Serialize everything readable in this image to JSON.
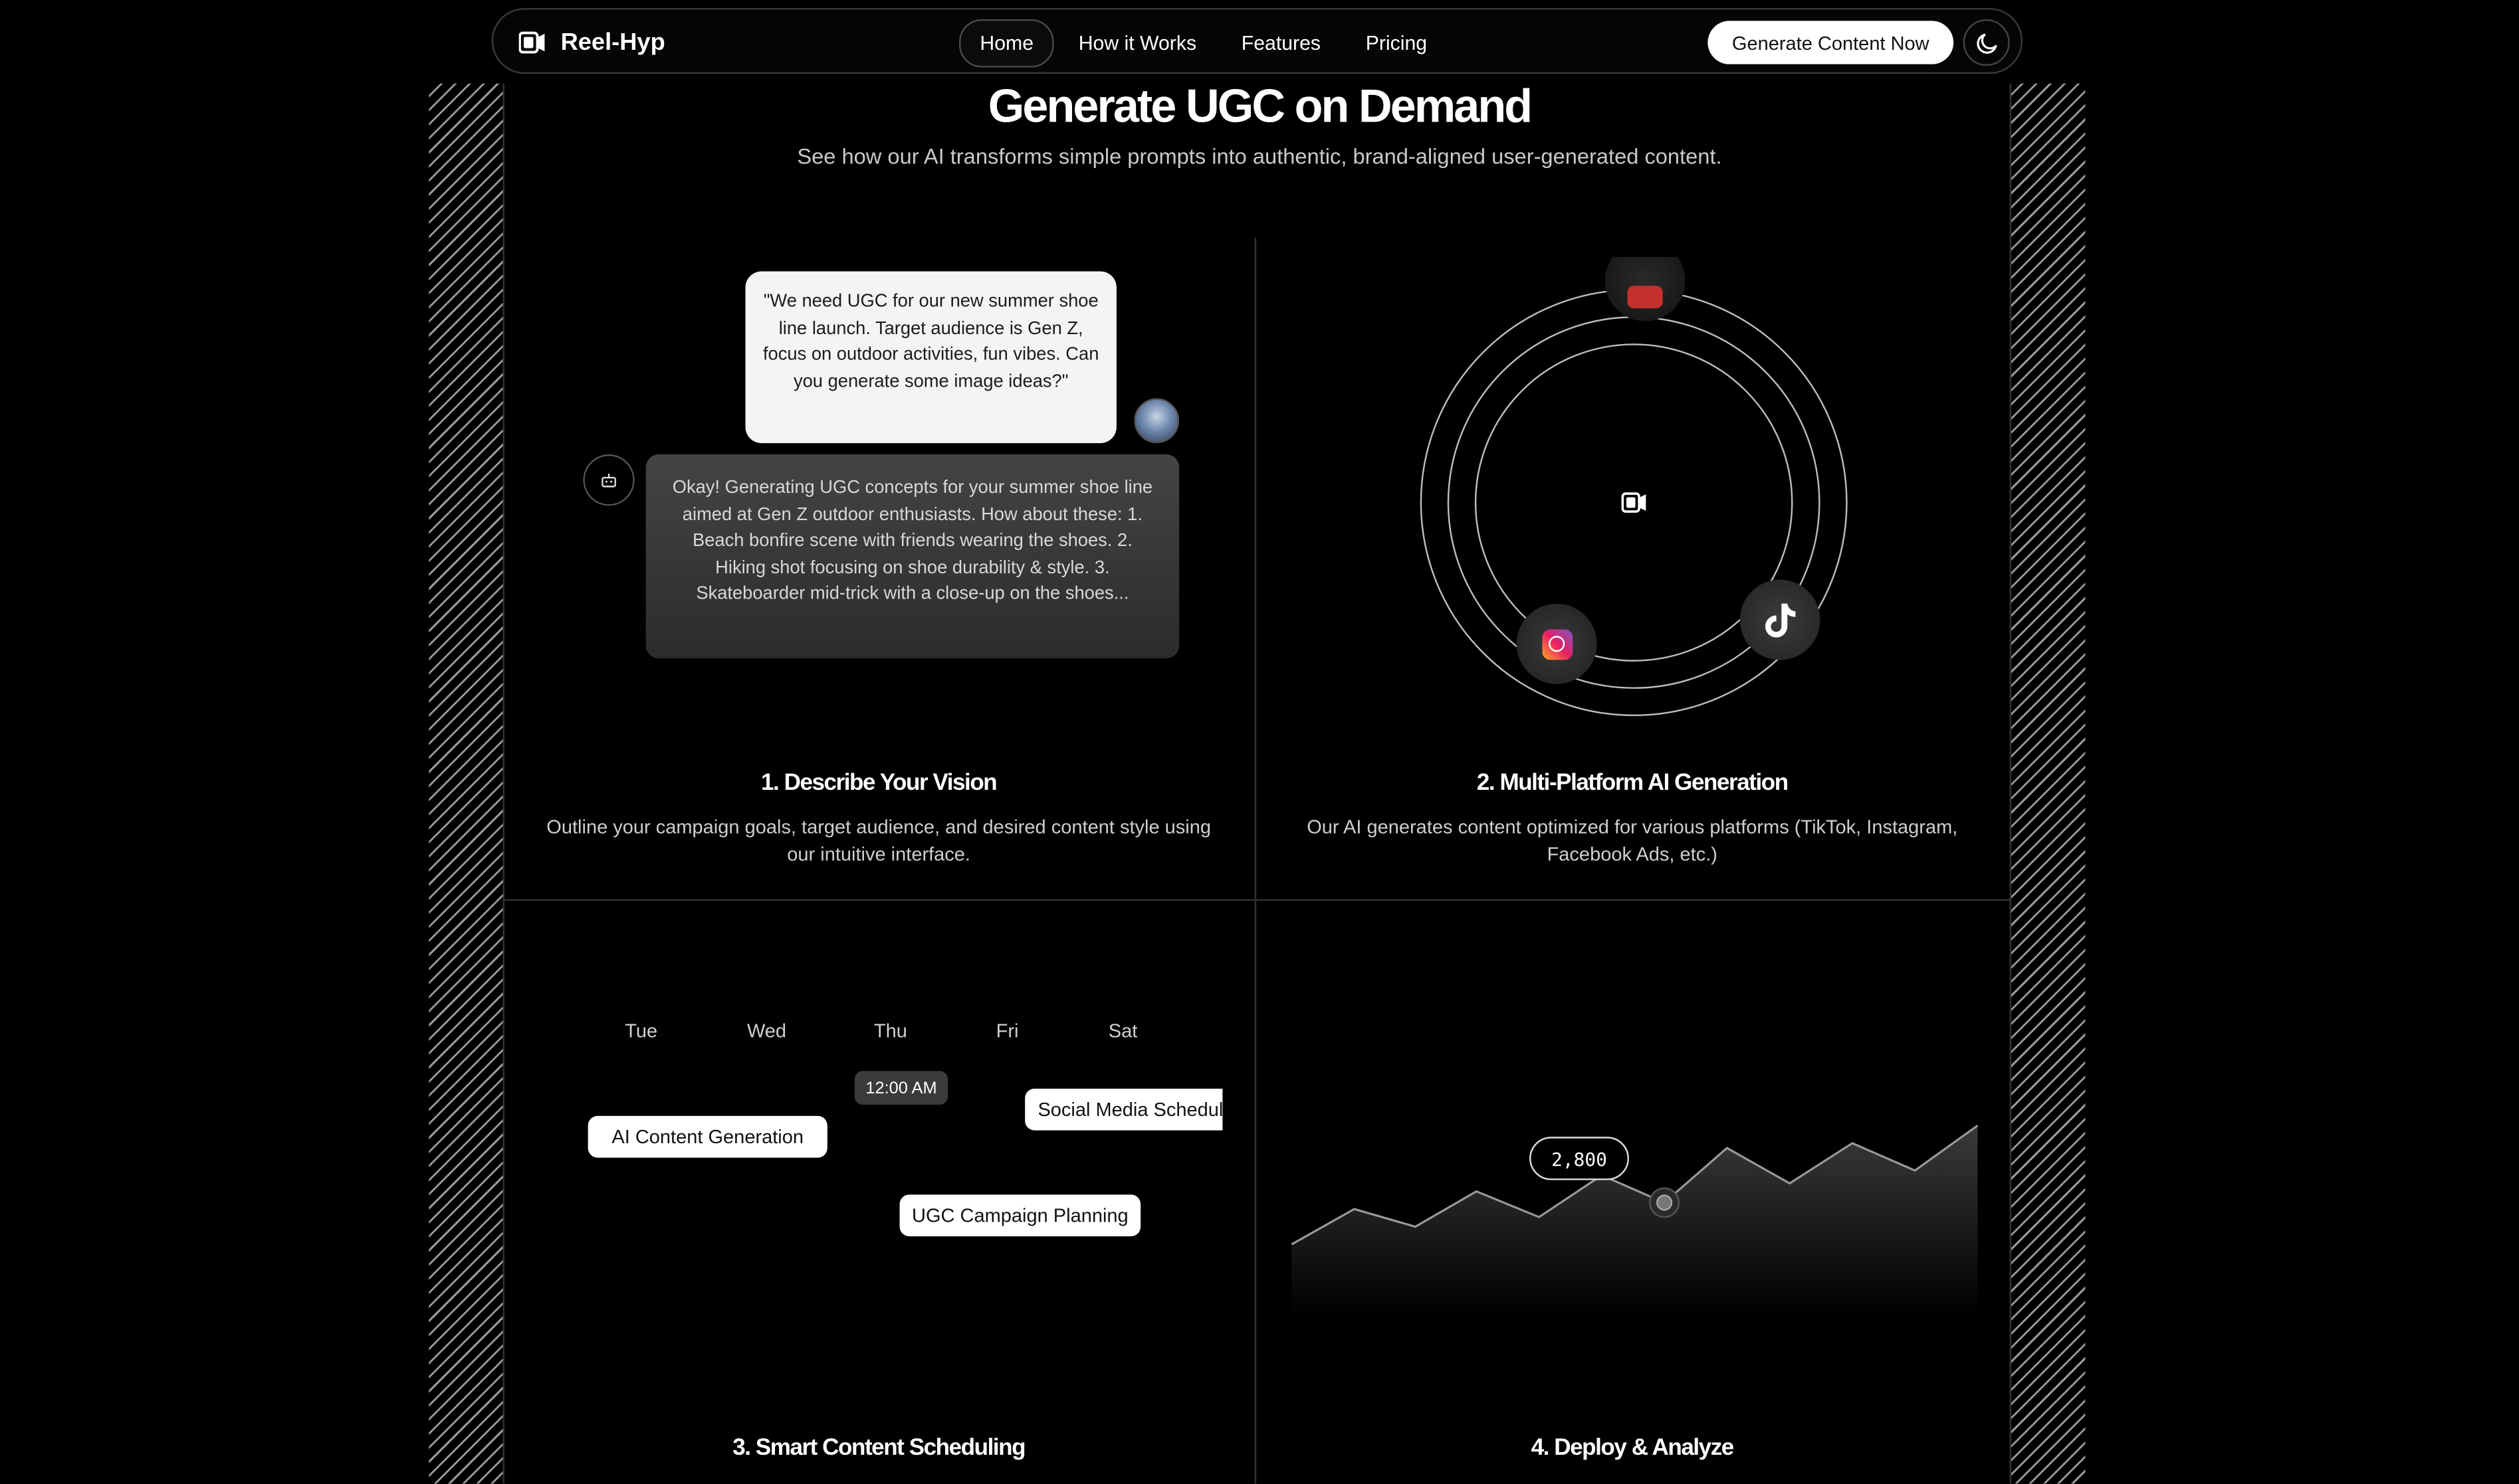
{
  "brand": {
    "name": "Reel-Hyp"
  },
  "nav": {
    "links": [
      "Home",
      "How it Works",
      "Features",
      "Pricing"
    ],
    "active": "Home",
    "cta": "Generate Content Now"
  },
  "hero": {
    "title": "Generate UGC on Demand",
    "subtitle": "See how our AI transforms simple prompts into authentic, brand-aligned user-generated content."
  },
  "steps": {
    "s1": {
      "title": "1. Describe Your Vision",
      "desc_line1": "Outline your campaign goals, target audience, and desired content style using",
      "desc_line2": "our intuitive interface.",
      "user_msg": "\"We need UGC for our new summer shoe line launch. Target audience is Gen Z, focus on outdoor activities, fun vibes. Can you generate some image ideas?\"",
      "ai_msg": "Okay! Generating UGC concepts for your summer shoe line aimed at Gen Z outdoor enthusiasts. How about these: 1. Beach bonfire scene with friends wearing the shoes. 2. Hiking shot focusing on shoe durability & style. 3. Skateboarder mid-trick with a close-up on the shoes..."
    },
    "s2": {
      "title": "2. Multi-Platform AI Generation",
      "desc_line1": "Our AI generates content optimized for various platforms (TikTok, Instagram,",
      "desc_line2": "Facebook Ads, etc.)",
      "platform_icons": [
        "youtube-icon",
        "instagram-icon",
        "tiktok-icon"
      ]
    },
    "s3": {
      "title": "3. Smart Content Scheduling",
      "days": [
        "Tue",
        "Wed",
        "Thu",
        "Fri",
        "Sat"
      ],
      "time": "12:00 AM",
      "events": [
        "AI Content Generation",
        "Social Media Scheduling",
        "UGC Campaign Planning"
      ]
    },
    "s4": {
      "title": "4. Deploy & Analyze",
      "highlight_value": "2,800"
    }
  },
  "colors": {
    "background": "#000000",
    "text": "#ffffff",
    "muted": "#c9c9c9",
    "accent_light": "#f4f4f4"
  }
}
